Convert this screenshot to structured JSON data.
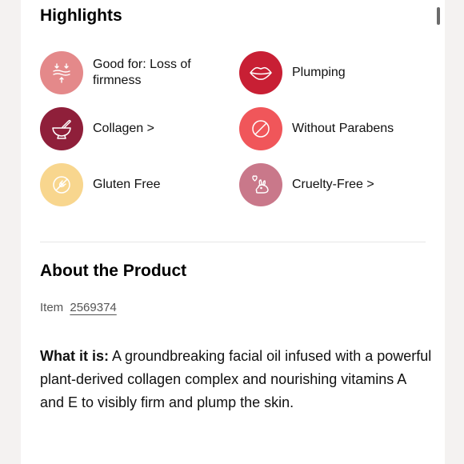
{
  "highlights": {
    "title": "Highlights",
    "items": [
      {
        "label": "Good for: Loss of firmness",
        "icon": "firmness-arrows-icon",
        "color": "#e4898a"
      },
      {
        "label": "Plumping",
        "icon": "lips-icon",
        "color": "#c81f34"
      },
      {
        "label": "Collagen >",
        "icon": "mortar-pestle-icon",
        "color": "#8f1f3a"
      },
      {
        "label": "Without Parabens",
        "icon": "prohibited-icon",
        "color": "#f0565a"
      },
      {
        "label": "Gluten Free",
        "icon": "wheat-crossed-icon",
        "color": "#f8d68e"
      },
      {
        "label": "Cruelty-Free >",
        "icon": "bunny-heart-icon",
        "color": "#c9788a"
      }
    ]
  },
  "about": {
    "title": "About the Product",
    "item_prefix": "Item",
    "item_number": "2569374",
    "what_it_is_label": "What it is:",
    "what_it_is_text": " A groundbreaking facial oil infused with a powerful plant-derived collagen complex and nourishing vitamins A and E to visibly firm and plump the skin."
  }
}
